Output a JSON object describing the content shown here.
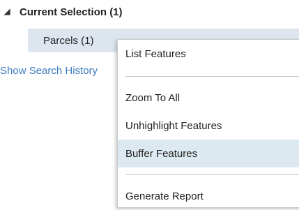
{
  "tree": {
    "toggle_glyph": "◢",
    "header_label": "Current Selection (1)",
    "row_label": "Parcels (1)"
  },
  "search_history_link": "Show Search History",
  "context_menu": {
    "items": [
      {
        "label": "List Features"
      },
      {
        "label": "Zoom To All"
      },
      {
        "label": "Unhighlight Features"
      },
      {
        "label": "Buffer Features",
        "state": "hover"
      },
      {
        "label": "Generate Report"
      }
    ]
  },
  "colors": {
    "selected_row": "#dde6ee",
    "menu_hover": "#dde9f0",
    "link": "#3a7bbf"
  }
}
